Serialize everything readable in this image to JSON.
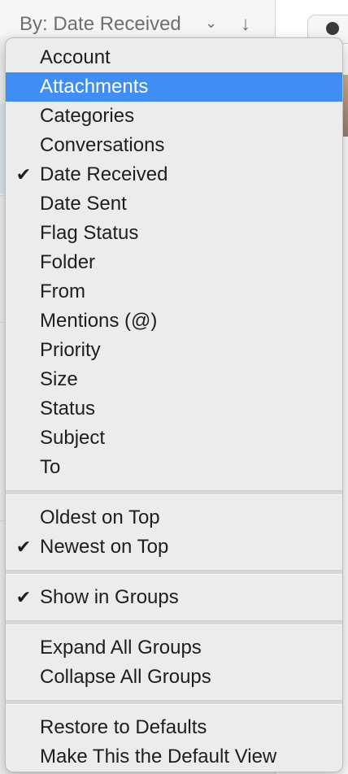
{
  "toolbar": {
    "sort_label": "By: Date Received",
    "chevron_icon": "chevron-down-icon",
    "direction_icon": "arrow-down-icon"
  },
  "menu": {
    "sort_by": [
      {
        "label": "Account",
        "checked": false,
        "selected": false
      },
      {
        "label": "Attachments",
        "checked": false,
        "selected": true
      },
      {
        "label": "Categories",
        "checked": false,
        "selected": false
      },
      {
        "label": "Conversations",
        "checked": false,
        "selected": false
      },
      {
        "label": "Date Received",
        "checked": true,
        "selected": false
      },
      {
        "label": "Date Sent",
        "checked": false,
        "selected": false
      },
      {
        "label": "Flag Status",
        "checked": false,
        "selected": false
      },
      {
        "label": "Folder",
        "checked": false,
        "selected": false
      },
      {
        "label": "From",
        "checked": false,
        "selected": false
      },
      {
        "label": "Mentions (@)",
        "checked": false,
        "selected": false
      },
      {
        "label": "Priority",
        "checked": false,
        "selected": false
      },
      {
        "label": "Size",
        "checked": false,
        "selected": false
      },
      {
        "label": "Status",
        "checked": false,
        "selected": false
      },
      {
        "label": "Subject",
        "checked": false,
        "selected": false
      },
      {
        "label": "To",
        "checked": false,
        "selected": false
      }
    ],
    "order": [
      {
        "label": "Oldest on Top",
        "checked": false
      },
      {
        "label": "Newest on Top",
        "checked": true
      }
    ],
    "grouping": [
      {
        "label": "Show in Groups",
        "checked": true
      }
    ],
    "groups": [
      {
        "label": "Expand All Groups"
      },
      {
        "label": "Collapse All Groups"
      }
    ],
    "defaults": [
      {
        "label": "Restore to Defaults"
      },
      {
        "label": "Make This the Default View"
      }
    ],
    "check_glyph": "✔"
  },
  "colors": {
    "selection": "#3f8ef5",
    "menu_bg": "#ececec",
    "text": "#1e1e1e"
  }
}
